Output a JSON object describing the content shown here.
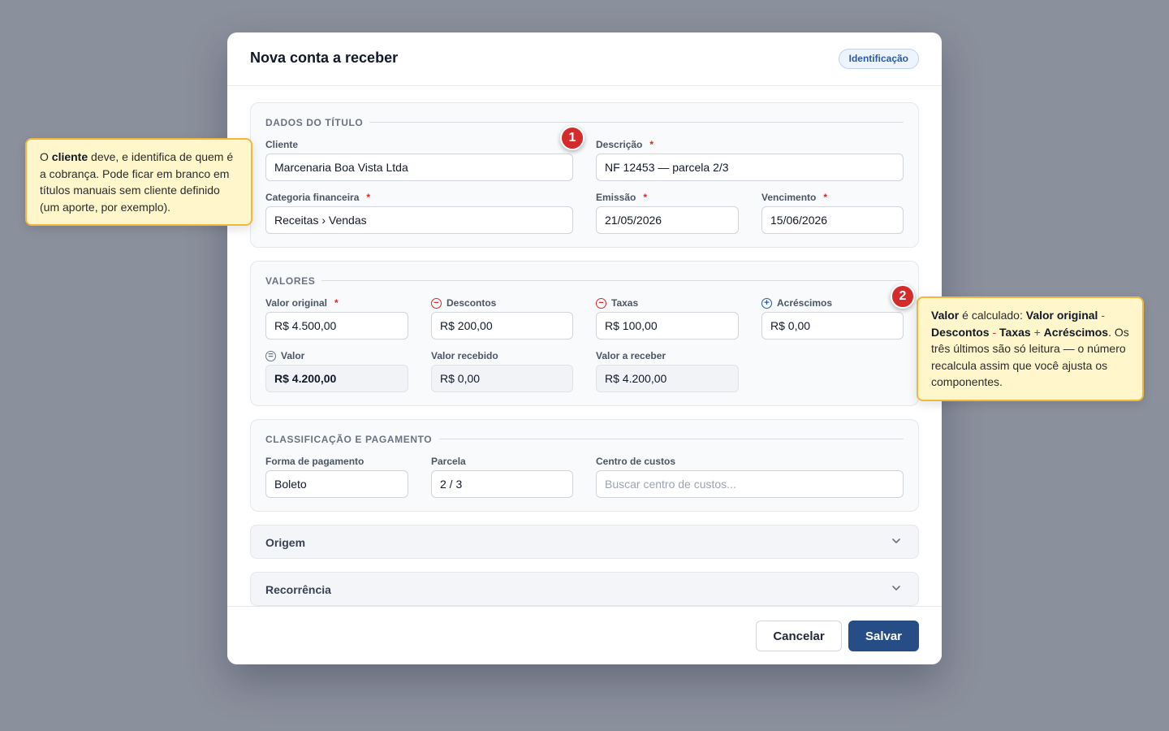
{
  "modal": {
    "title": "Nova conta a receber",
    "step_badge": "Identificação"
  },
  "dados_titulo": {
    "title": "DADOS DO TÍTULO",
    "cliente": {
      "label": "Cliente",
      "value": "Marcenaria Boa Vista Ltda"
    },
    "descricao": {
      "label": "Descrição",
      "required": "*",
      "value": "NF 12453 — parcela 2/3"
    },
    "categoria": {
      "label": "Categoria financeira",
      "required": "*",
      "value": "Receitas › Vendas"
    },
    "emissao": {
      "label": "Emissão",
      "required": "*",
      "value": "21/05/2026"
    },
    "vencimento": {
      "label": "Vencimento",
      "required": "*",
      "value": "15/06/2026"
    }
  },
  "valores": {
    "title": "VALORES",
    "valor_original": {
      "label": "Valor original",
      "required": "*",
      "value": "R$ 4.500,00"
    },
    "descontos": {
      "label": "Descontos",
      "icon": "minus-circle-icon",
      "value": "R$ 200,00"
    },
    "taxas": {
      "label": "Taxas",
      "icon": "minus-circle-icon",
      "value": "R$ 100,00"
    },
    "acrescimos": {
      "label": "Acréscimos",
      "icon": "plus-circle-icon",
      "value": "R$ 0,00"
    },
    "valor": {
      "label": "Valor",
      "icon": "equals-circle-icon",
      "value": "R$ 4.200,00"
    },
    "valor_recebido": {
      "label": "Valor recebido",
      "value": "R$ 0,00"
    },
    "valor_a_receber": {
      "label": "Valor a receber",
      "value": "R$ 4.200,00"
    }
  },
  "classificacao": {
    "title": "CLASSIFICAÇÃO E PAGAMENTO",
    "forma_pagamento": {
      "label": "Forma de pagamento",
      "value": "Boleto"
    },
    "parcela": {
      "label": "Parcela",
      "value": "2 / 3"
    },
    "centro_custos": {
      "label": "Centro de custos",
      "value": "",
      "placeholder": "Buscar centro de custos..."
    }
  },
  "accordions": {
    "origem": "Origem",
    "recorrencia": "Recorrência"
  },
  "footer": {
    "cancel_label": "Cancelar",
    "save_label": "Salvar"
  },
  "callouts": {
    "one": {
      "marker": "1",
      "t1": "O ",
      "b1": "cliente",
      "t2": " deve, e identifica de quem é a cobrança. Pode ficar em branco em títulos manuais sem cliente definido (um aporte, por exemplo)."
    },
    "two": {
      "marker": "2",
      "b1": "Valor",
      "t1": " é calculado: ",
      "b2": "Valor original",
      "op1": " - ",
      "b3": "Descontos",
      "op2": " - ",
      "b4": "Taxas",
      "op3": " + ",
      "b5": "Acréscimos",
      "t2": ". Os três últimos são só leitura — o número recalcula assim que você ajusta os componentes."
    }
  },
  "colors": {
    "accent": "#264d85",
    "required": "#dc2626",
    "callout_bg": "#fff6cc",
    "callout_border": "#f2b73f",
    "marker": "#d42b2b"
  }
}
